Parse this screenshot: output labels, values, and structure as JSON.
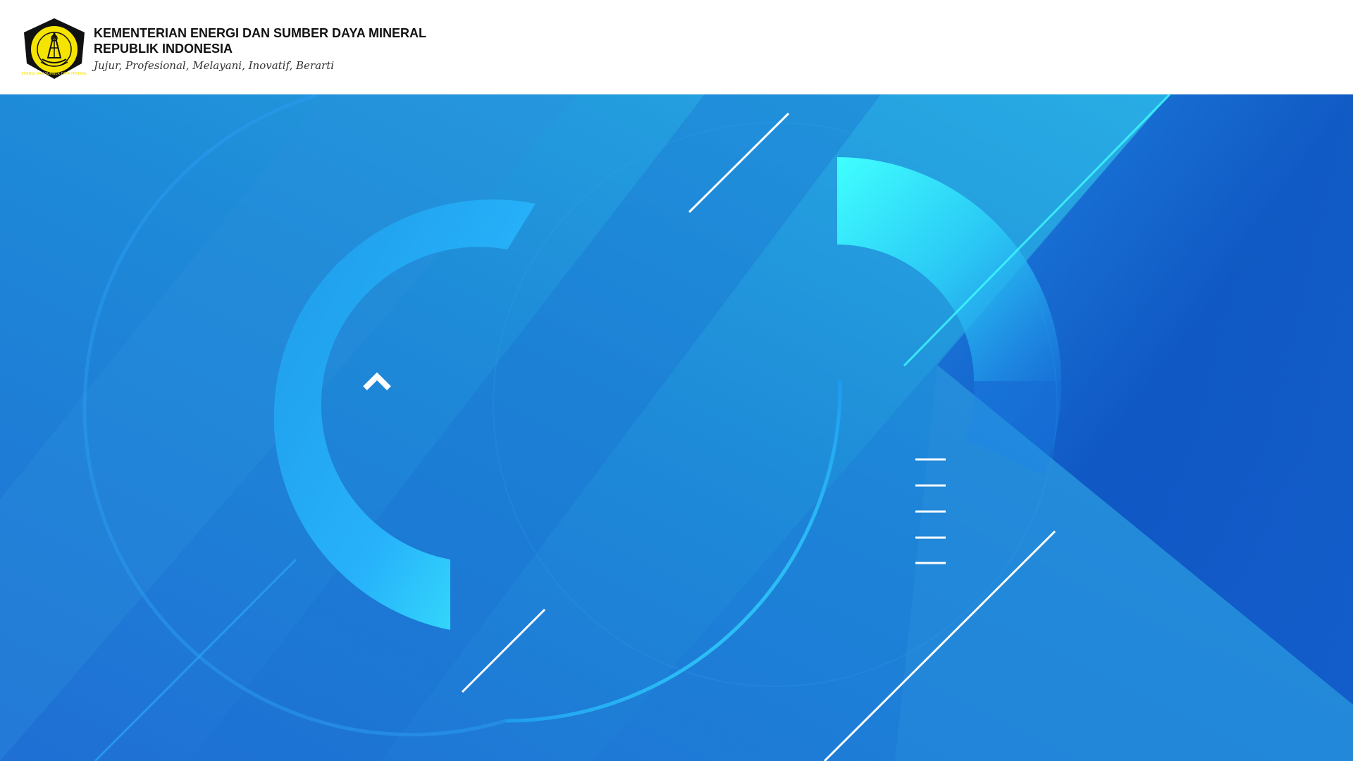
{
  "header": {
    "org_name_line1": "KEMENTERIAN ENERGI DAN SUMBER DAYA MINERAL",
    "org_name_line2": "REPUBLIK INDONESIA",
    "motto": "Jujur, Profesional, Melayani, Inovatif, Berarti",
    "logo_ring_text": "ENERGI DAN SUMBER DAYA MINERAL"
  },
  "icons": {
    "logo": "esdm-emblem-icon",
    "chevron": "chevron-up-icon",
    "menu": "menu-lines-icon"
  },
  "colors": {
    "background_blue": "#1B7FD6",
    "deep_blue": "#0D4FC0",
    "cyan": "#3FFBFF",
    "light_cyan": "#2EBDEB",
    "logo_yellow": "#F5E400",
    "logo_black": "#111111"
  }
}
